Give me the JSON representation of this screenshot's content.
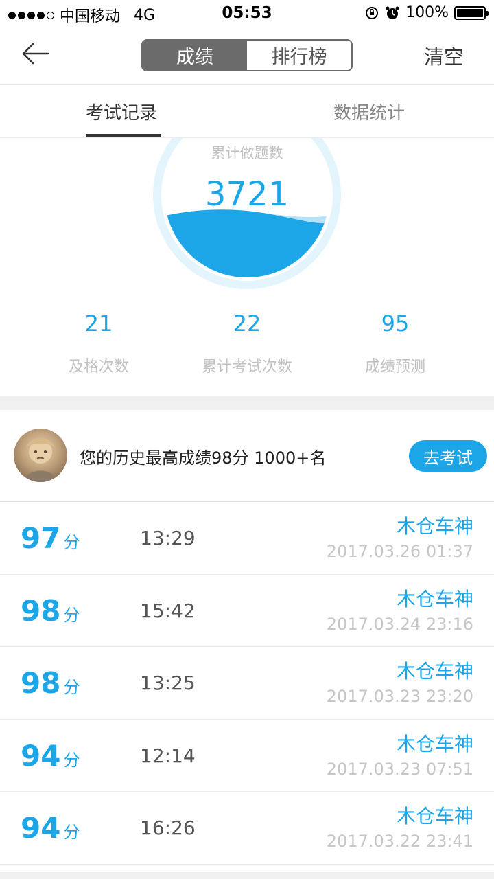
{
  "status_bar": {
    "carrier": "中国移动",
    "network": "4G",
    "time": "05:53",
    "battery": "100%"
  },
  "nav": {
    "back_icon": "arrow-left-icon",
    "segment": [
      "成绩",
      "排行榜"
    ],
    "active_segment": "成绩",
    "clear_label": "清空"
  },
  "tabs": [
    "考试记录",
    "数据统计"
  ],
  "active_tab": "考试记录",
  "gauge": {
    "title": "累计做题数",
    "value": "3721"
  },
  "stats": [
    {
      "value": "21",
      "label": "及格次数"
    },
    {
      "value": "22",
      "label": "累计考试次数"
    },
    {
      "value": "95",
      "label": "成绩预测"
    }
  ],
  "best": {
    "text": "您的历史最高成绩98分 1000+名",
    "button": "去考试"
  },
  "score_unit": "分",
  "records": [
    {
      "score": "97",
      "duration": "13:29",
      "name": "木仓车神",
      "date": "2017.03.26 01:37"
    },
    {
      "score": "98",
      "duration": "15:42",
      "name": "木仓车神",
      "date": "2017.03.24 23:16"
    },
    {
      "score": "98",
      "duration": "13:25",
      "name": "木仓车神",
      "date": "2017.03.23 23:20"
    },
    {
      "score": "94",
      "duration": "12:14",
      "name": "木仓车神",
      "date": "2017.03.23 07:51"
    },
    {
      "score": "94",
      "duration": "16:26",
      "name": "木仓车神",
      "date": "2017.03.22 23:41"
    }
  ],
  "colors": {
    "accent": "#1ca6e8",
    "segment_active": "#6b6b6b"
  }
}
